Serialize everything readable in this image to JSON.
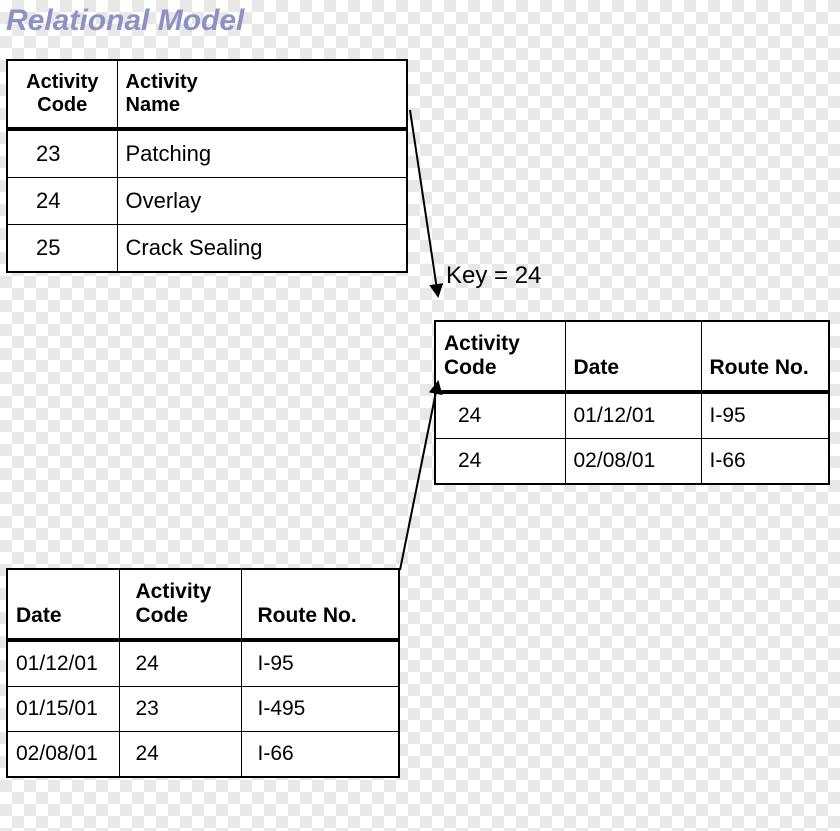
{
  "title": "Relational Model",
  "key_label": "Key = 24",
  "table1": {
    "headers": [
      "Activity Code",
      "Activity Name"
    ],
    "rows": [
      [
        "23",
        "Patching"
      ],
      [
        "24",
        "Overlay"
      ],
      [
        "25",
        "Crack Sealing"
      ]
    ]
  },
  "table2": {
    "headers": [
      "Date",
      "Activity Code",
      "Route No."
    ],
    "rows": [
      [
        "01/12/01",
        "24",
        "I-95"
      ],
      [
        "01/15/01",
        "23",
        "I-495"
      ],
      [
        "02/08/01",
        "24",
        "I-66"
      ]
    ]
  },
  "table3": {
    "headers": [
      "Activity Code",
      "Date",
      "Route No."
    ],
    "rows": [
      [
        "24",
        "01/12/01",
        "I-95"
      ],
      [
        "24",
        "02/08/01",
        "I-66"
      ]
    ]
  }
}
